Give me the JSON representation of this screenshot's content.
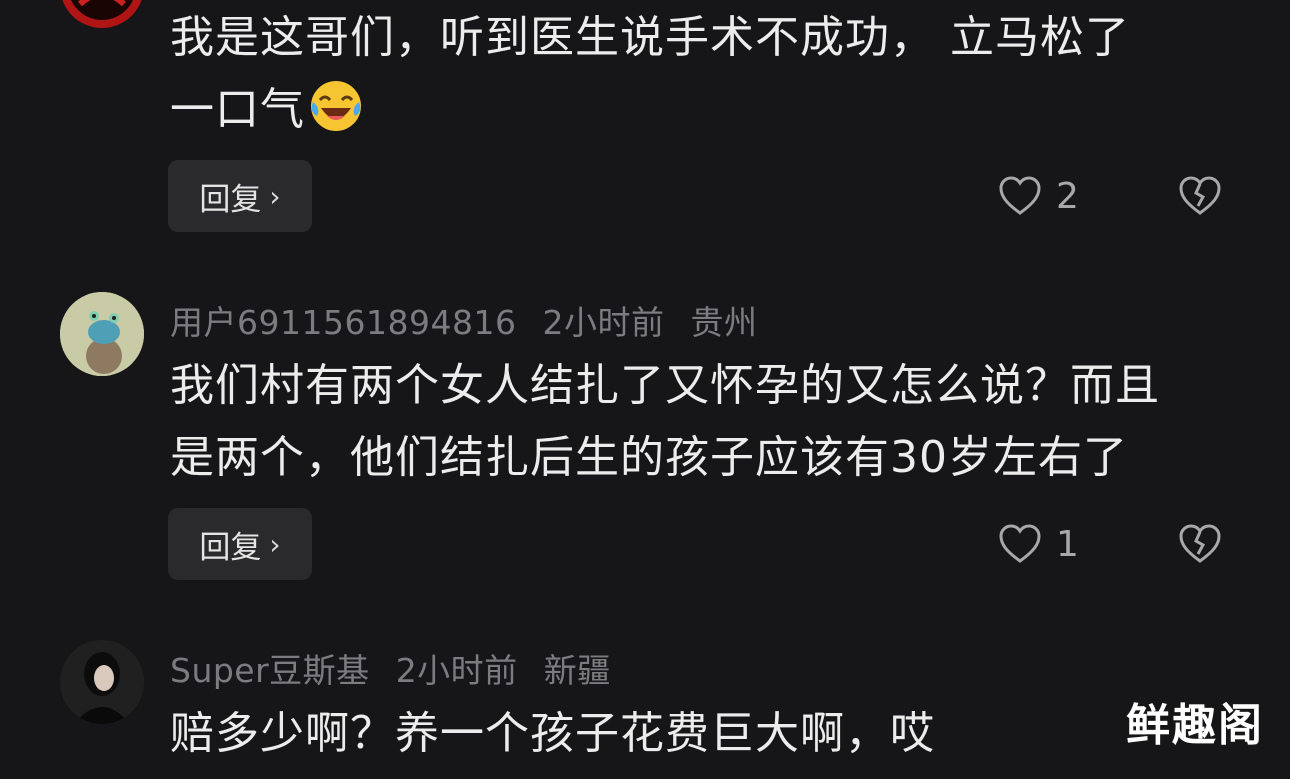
{
  "comments": [
    {
      "username": "",
      "time": "",
      "location": "",
      "lines": [
        "我是这哥们，听到医生说手术不成功，  立马松了",
        "一口气"
      ],
      "reply_label": "回复",
      "likes": "2",
      "emoji_icon": "laughing-tears-emoji"
    },
    {
      "username": "用户6911561894816",
      "time": "2小时前",
      "location": "贵州",
      "lines": [
        "我们村有两个女人结扎了又怀孕的又怎么说？而且",
        "是两个，他们结扎后生的孩子应该有30岁左右了"
      ],
      "reply_label": "回复",
      "likes": "1"
    },
    {
      "username": "Super豆斯基",
      "time": "2小时前",
      "location": "新疆",
      "lines": [
        "赔多少啊？养一个孩子花费巨大啊，哎"
      ]
    }
  ],
  "watermark": "鲜趣阁",
  "colors": {
    "background": "#161618",
    "meta_text": "#7c7c80",
    "reply_button_bg": "#2a2a2c"
  }
}
